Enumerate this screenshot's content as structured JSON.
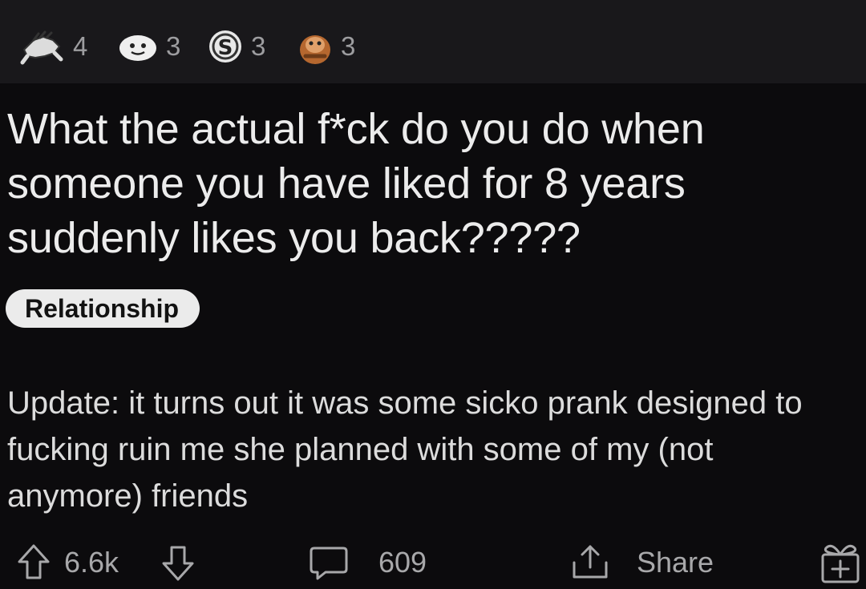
{
  "awards": [
    {
      "icon": "fist-bump-award-icon",
      "count": "4"
    },
    {
      "icon": "blob-face-award-icon",
      "count": "3"
    },
    {
      "icon": "coin-s-award-icon",
      "count": "3"
    },
    {
      "icon": "monkey-award-icon",
      "count": "3"
    }
  ],
  "post": {
    "title": "What the actual f*ck do you do when someone you have liked for 8 years suddenly likes you back?????",
    "flair": "Relationship",
    "body": "Update: it turns out it was some sicko prank designed to fucking ruin me she planned with some of my (not anymore) friends"
  },
  "actions": {
    "votes": "6.6k",
    "comments": "609",
    "share_label": "Share",
    "icons": [
      "upvote-arrow-icon",
      "downvote-arrow-icon",
      "comment-bubble-icon",
      "share-icon",
      "gift-award-icon"
    ]
  },
  "colors": {
    "background": "#0c0b0d",
    "awards_bar": "#19181b",
    "flair_background": "#ebebeb",
    "text": "#ececec",
    "muted": "#a8a8aa"
  }
}
